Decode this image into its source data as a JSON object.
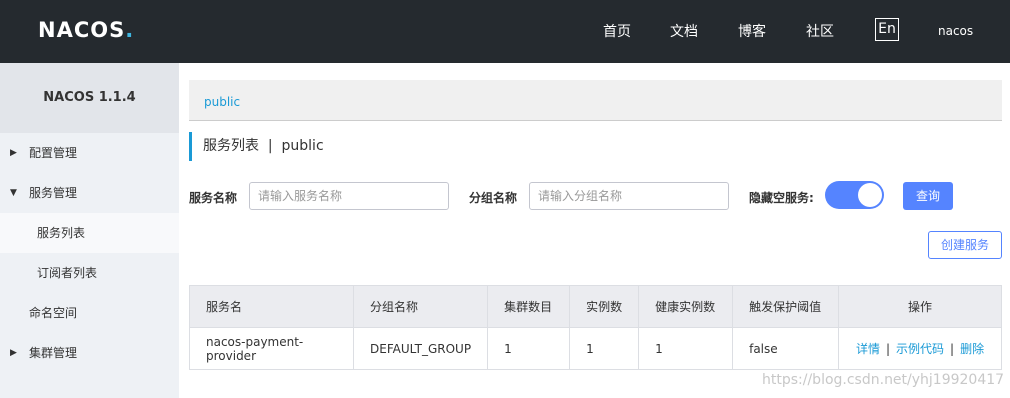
{
  "header": {
    "logo": "NACOS",
    "logo_dot": ".",
    "nav": [
      "首页",
      "文档",
      "博客",
      "社区"
    ],
    "lang": "En",
    "user": "nacos"
  },
  "sidebar": {
    "version": "NACOS 1.1.4",
    "items": [
      {
        "label": "配置管理",
        "arrow": "▶"
      },
      {
        "label": "服务管理",
        "arrow": "▼"
      },
      {
        "label": "服务列表"
      },
      {
        "label": "订阅者列表"
      },
      {
        "label": "命名空间"
      },
      {
        "label": "集群管理",
        "arrow": "▶"
      }
    ]
  },
  "breadcrumb": "public",
  "page_title": "服务列表  |  public",
  "filters": {
    "service_name_label": "服务名称",
    "service_name_placeholder": "请输入服务名称",
    "group_name_label": "分组名称",
    "group_name_placeholder": "请输入分组名称",
    "hide_empty_label": "隐藏空服务:",
    "hide_empty_on": true,
    "query_button": "查询"
  },
  "create_button": "创建服务",
  "table": {
    "columns": [
      "服务名",
      "分组名称",
      "集群数目",
      "实例数",
      "健康实例数",
      "触发保护阈值",
      "操作"
    ],
    "rows": [
      {
        "service": "nacos-payment-provider",
        "group": "DEFAULT_GROUP",
        "clusters": "1",
        "instances": "1",
        "healthy": "1",
        "threshold": "false",
        "actions": [
          "详情",
          "示例代码",
          "删除"
        ],
        "separator": "|"
      }
    ]
  },
  "watermark": "https://blog.csdn.net/yhj19920417",
  "colors": {
    "header_bg": "#252a2f",
    "accent": "#5584ff",
    "link": "#1a9ad6"
  }
}
